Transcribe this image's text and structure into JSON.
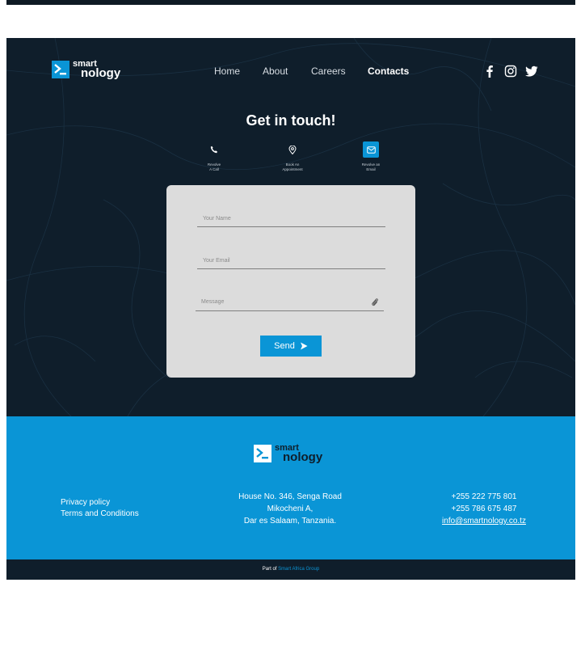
{
  "brand": {
    "line1": "smart",
    "line2": "nology"
  },
  "nav": [
    "Home",
    "About",
    "Careers",
    "Contacts"
  ],
  "social": [
    "facebook-icon",
    "instagram-icon",
    "twitter-icon"
  ],
  "contact_section": {
    "title": "Get in touch!",
    "options": [
      {
        "line1": "Revolve",
        "line2": "A Call",
        "icon": "phone-icon",
        "selected": false
      },
      {
        "line1": "Book An",
        "line2": "Appointment",
        "icon": "location-pin-icon",
        "selected": false
      },
      {
        "line1": "Revolve an",
        "line2": "Email",
        "icon": "envelope-icon",
        "selected": true
      }
    ]
  },
  "form": {
    "name_placeholder": "Your Name",
    "email_placeholder": "Your Email",
    "message_placeholder": "Message",
    "send_label": "Send"
  },
  "footer": {
    "links": [
      "Privacy policy",
      "Terms and Conditions"
    ],
    "address": [
      "House No. 346, Senga Road",
      "Mikocheni A,",
      "Dar es Salaam, Tanzania."
    ],
    "phone1": "+255 222 775 801",
    "phone2": "+255 786 675 487",
    "email": "info@smartnology.co.tz"
  },
  "bottom_bar": {
    "prefix": "Part of",
    "group": "Smart Africa Group"
  },
  "colors": {
    "accent": "#0a95d6",
    "dark": "#0f1e2b",
    "card": "#dcdcdc"
  }
}
